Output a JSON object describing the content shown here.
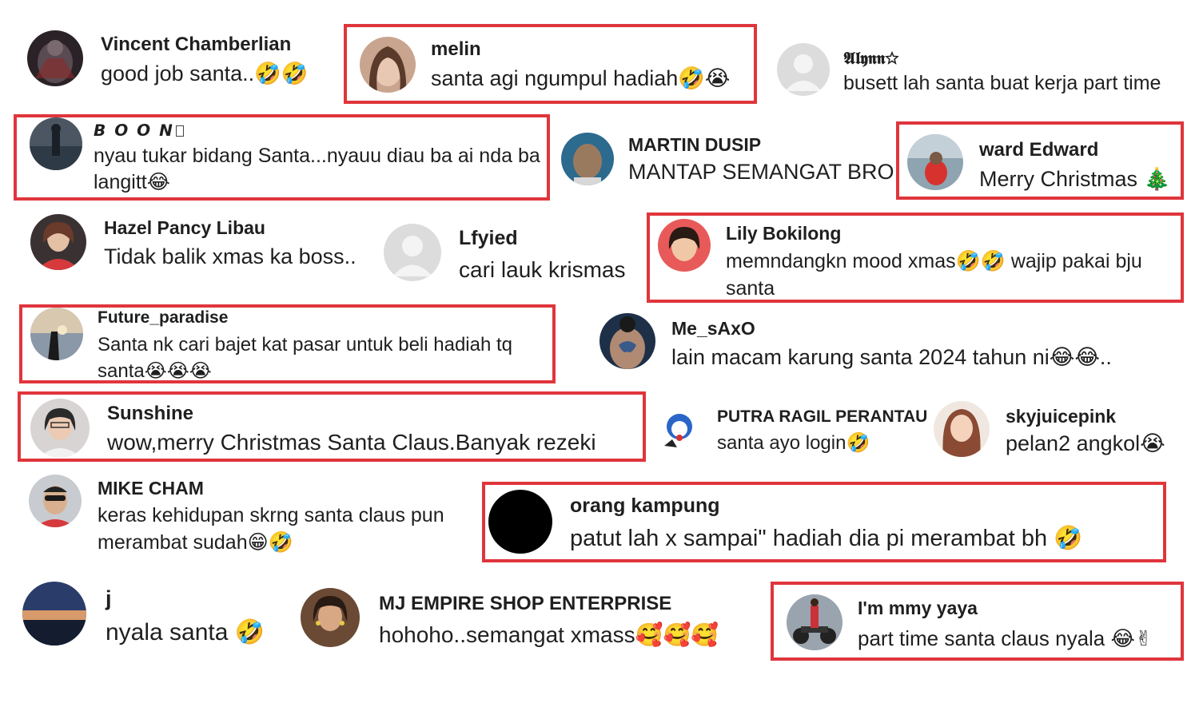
{
  "colors": {
    "highlight_border": "#e0353c",
    "text": "#1f1f1f",
    "background": "#ffffff"
  },
  "comments": [
    {
      "username": "Vincent Chamberlian",
      "text": "good job santa..🤣🤣",
      "avatar": "dark-armored-figure"
    },
    {
      "username": "melin",
      "text": "santa agi ngumpul hadiah🤣😭",
      "avatar": "woman-portrait",
      "highlighted": true
    },
    {
      "username": "𝕬𝖑𝖞𝖓𝖓☆",
      "text": "busett lah santa buat kerja part time",
      "avatar": "default-user-icon"
    },
    {
      "username": "𝘽 𝙊 𝙊 𝙉",
      "text": "nyau tukar bidang Santa...nyauu diau ba ai nda ba langitt😂",
      "avatar": "person-outdoors",
      "highlighted": true
    },
    {
      "username": "MARTIN DUSIP",
      "text": "MANTAP SEMANGAT BRO",
      "avatar": "man-portrait"
    },
    {
      "username": "ward Edward",
      "text": "Merry Christmas 🎄",
      "avatar": "person-red-shirt",
      "highlighted": true
    },
    {
      "username": "Hazel Pancy Libau",
      "text": "Tidak balik xmas ka boss..",
      "avatar": "woman-red-top"
    },
    {
      "username": "Lfyied",
      "text": "cari lauk krismas",
      "avatar": "default-user-icon"
    },
    {
      "username": "Lily Bokilong",
      "text": "memndangkn mood xmas🤣🤣 wajip pakai bju santa",
      "avatar": "smiling-woman",
      "highlighted": true
    },
    {
      "username": "Future_paradise",
      "text": "Santa nk cari bajet kat pasar untuk beli hadiah tq santa😭😭😭",
      "avatar": "silhouette-sunset",
      "highlighted": true
    },
    {
      "username": "Me_sAxO",
      "text": "lain macam karung santa 2024 tahun ni😂😂..",
      "avatar": "back-tattoo"
    },
    {
      "username": "Sunshine",
      "text": "wow,merry Christmas Santa Claus.Banyak rezeki",
      "avatar": "woman-glasses",
      "highlighted": true
    },
    {
      "username": "PUTRA RAGIL PERANTAU",
      "text": "santa ayo login🤣",
      "avatar": "cartoon-character"
    },
    {
      "username": "skyjuicepink",
      "text": "pelan2 angkol😭",
      "avatar": "illustrated-girl"
    },
    {
      "username": "MIKE CHAM",
      "text": "keras kehidupan skrng santa claus pun merambat sudah😁🤣",
      "avatar": "man-sunglasses"
    },
    {
      "username": "orang kampung",
      "text": "patut lah x sampai\" hadiah dia pi merambat bh 🤣",
      "avatar": "black-circle",
      "highlighted": true
    },
    {
      "username": "j",
      "text": "nyala santa 🤣",
      "avatar": "sunset-sky"
    },
    {
      "username": "MJ EMPIRE SHOP ENTERPRISE",
      "text": "hohoho..semangat xmass🥰🥰🥰",
      "avatar": "woman-earrings"
    },
    {
      "username": "I'm mmy yaya",
      "text": "part time santa claus nyala 😂✌",
      "avatar": "woman-motorbike",
      "highlighted": true
    }
  ]
}
